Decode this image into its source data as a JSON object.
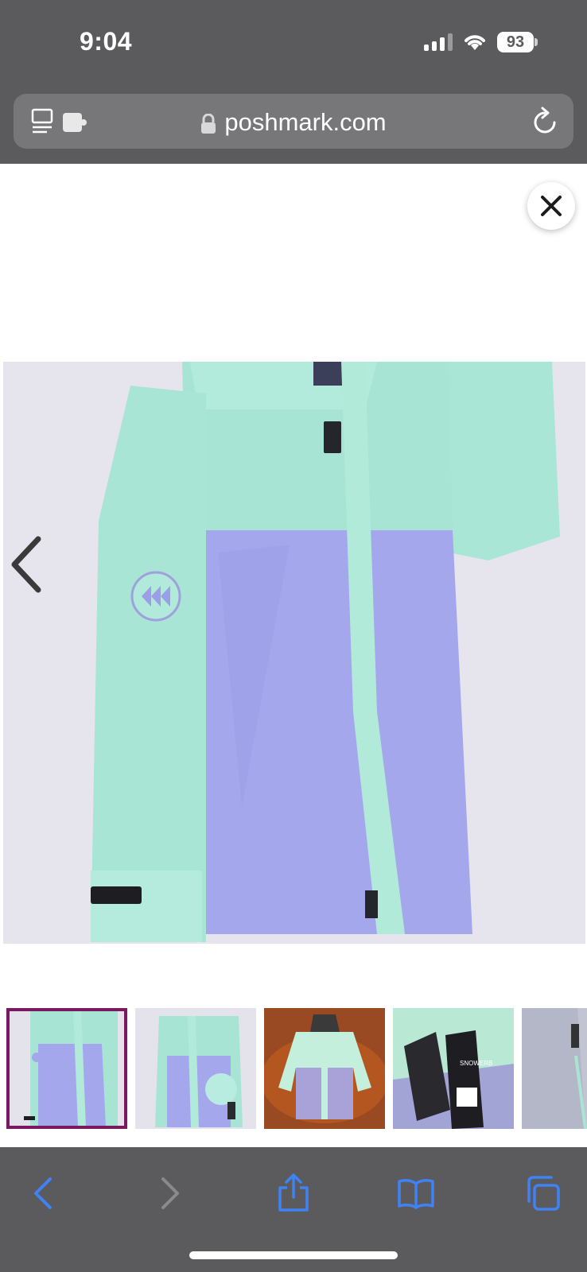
{
  "status_bar": {
    "time": "9:04",
    "battery_level": "93",
    "icons": [
      "cellular-signal-icon",
      "wifi-icon",
      "battery-icon"
    ]
  },
  "address_bar": {
    "url": "poshmark.com",
    "left_icon": "reader-extension-icon",
    "lock_icon": "lock-icon",
    "reload_icon": "reload-icon"
  },
  "viewer": {
    "close_icon": "close-icon",
    "prev_icon": "chevron-left-icon",
    "main_photo": "mint-and-lavender-ski-jacket-photo",
    "thumbnails": [
      {
        "name": "thumbnail-1",
        "selected": true
      },
      {
        "name": "thumbnail-2",
        "selected": false
      },
      {
        "name": "thumbnail-3",
        "selected": false
      },
      {
        "name": "thumbnail-4",
        "selected": false
      },
      {
        "name": "thumbnail-5",
        "selected": false
      }
    ],
    "thumbnail_4_tag_text": "SNOWERB"
  },
  "toolbar": {
    "items": [
      "back-icon",
      "forward-icon",
      "share-icon",
      "bookmarks-icon",
      "tabs-icon"
    ]
  },
  "colors": {
    "chrome": "#5b5b5d",
    "accent": "#3f82f4",
    "selected_border": "#7a1960",
    "jacket_mint": "#a6e3d2",
    "jacket_lavender": "#a3a6ea"
  }
}
